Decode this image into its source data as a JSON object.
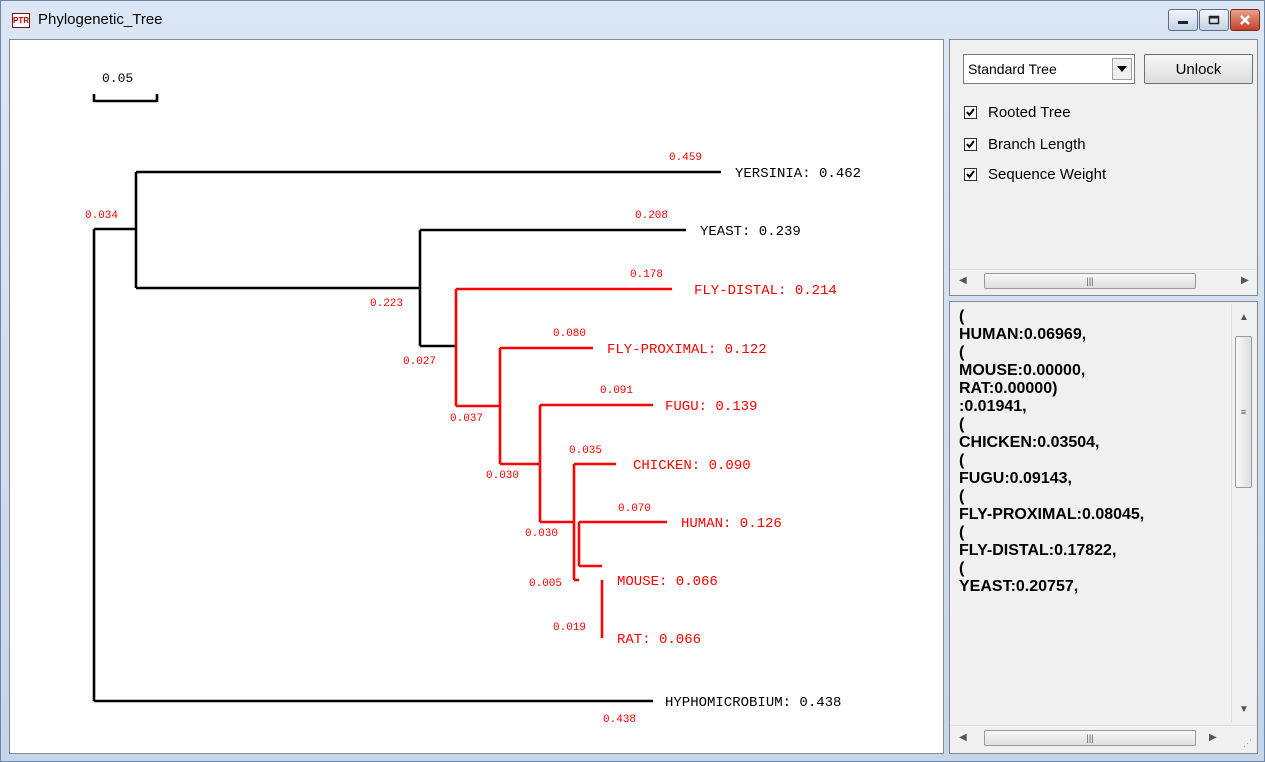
{
  "window": {
    "title": "Phylogenetic_Tree",
    "app_icon_text": "PTR",
    "icons": [
      "minimize-icon",
      "maximize-icon",
      "close-icon"
    ]
  },
  "controls": {
    "tree_type": "Standard Tree",
    "unlock_label": "Unlock",
    "options": [
      {
        "label": "Rooted Tree",
        "checked": true
      },
      {
        "label": "Branch Length",
        "checked": true
      },
      {
        "label": "Sequence Weight",
        "checked": true
      }
    ]
  },
  "newick_text": "(\nHUMAN:0.06969,\n(\nMOUSE:0.00000,\nRAT:0.00000)\n:0.01941,\n(\nCHICKEN:0.03504,\n(\nFUGU:0.09143,\n(\nFLY-PROXIMAL:0.08045,\n(\nFLY-DISTAL:0.17822,\n(\nYEAST:0.20757,",
  "tree": {
    "scale_label": "0.05",
    "leaves": [
      {
        "name": "YERSINIA",
        "weight": "0.462",
        "branch_length": "0.459",
        "highlighted": false
      },
      {
        "name": "YEAST",
        "weight": "0.239",
        "branch_length": "0.208",
        "highlighted": false
      },
      {
        "name": "FLY-DISTAL",
        "weight": "0.214",
        "branch_length": "0.178",
        "highlighted": true
      },
      {
        "name": "FLY-PROXIMAL",
        "weight": "0.122",
        "branch_length": "0.080",
        "highlighted": true
      },
      {
        "name": "FUGU",
        "weight": "0.139",
        "branch_length": "0.091",
        "highlighted": true
      },
      {
        "name": "CHICKEN",
        "weight": "0.090",
        "branch_length": "0.035",
        "highlighted": true
      },
      {
        "name": "HUMAN",
        "weight": "0.126",
        "branch_length": "0.070",
        "highlighted": true
      },
      {
        "name": "MOUSE",
        "weight": "0.066",
        "branch_length": "",
        "highlighted": true
      },
      {
        "name": "RAT",
        "weight": "0.066",
        "branch_length": "",
        "highlighted": true
      },
      {
        "name": "HYPHOMICROBIUM",
        "weight": "0.438",
        "branch_length": "0.438",
        "highlighted": false
      }
    ],
    "internal_branch_labels": [
      "0.034",
      "0.223",
      "0.027",
      "0.037",
      "0.030",
      "0.030",
      "0.005",
      "0.019"
    ],
    "colors": {
      "default": "#000000",
      "highlight": "#ff0000"
    }
  }
}
